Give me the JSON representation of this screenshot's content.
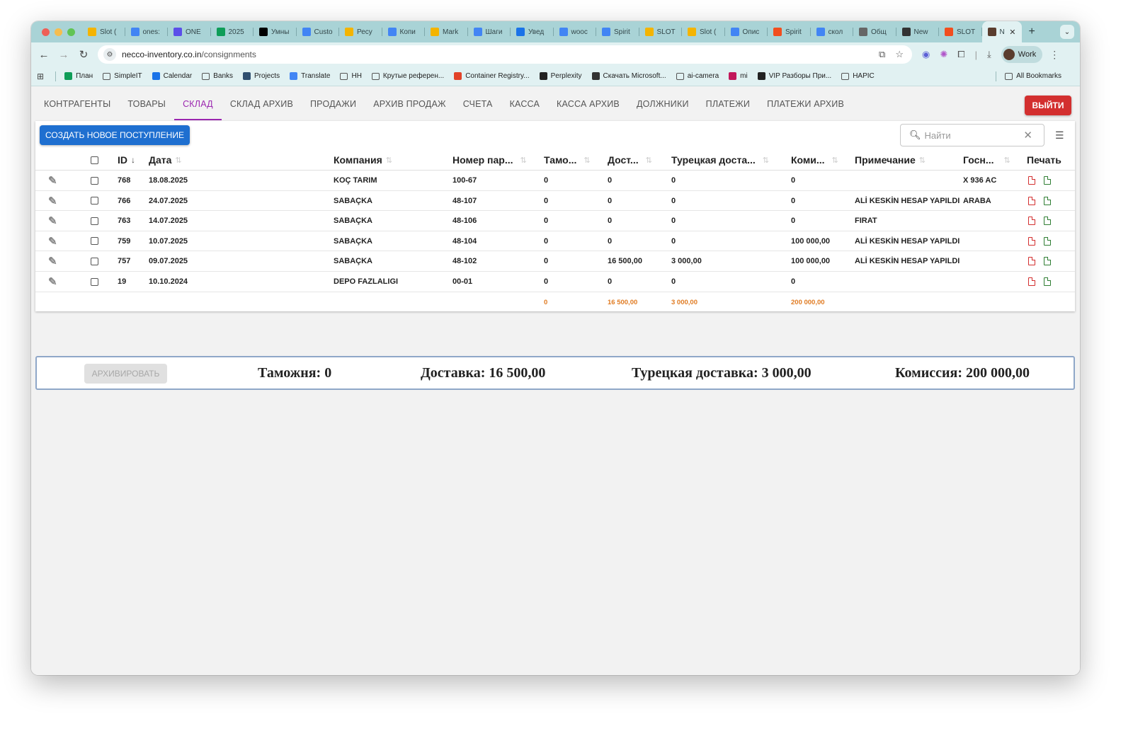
{
  "browser": {
    "tabs": [
      {
        "title": "Slot (",
        "icon": "google-drive-icon",
        "color": "#f4b400"
      },
      {
        "title": "ones:",
        "icon": "google-icon",
        "color": "#4285f4"
      },
      {
        "title": "ONE",
        "icon": "one-icon",
        "color": "#5b4fe9"
      },
      {
        "title": "2025",
        "icon": "sheets-icon",
        "color": "#0f9d58"
      },
      {
        "title": "Умны",
        "icon": "openai-icon",
        "color": "#000000"
      },
      {
        "title": "Custo",
        "icon": "google-icon",
        "color": "#4285f4"
      },
      {
        "title": "Ресу",
        "icon": "google-drive-icon",
        "color": "#f4b400"
      },
      {
        "title": "Копи",
        "icon": "docs-icon",
        "color": "#4285f4"
      },
      {
        "title": "Mark",
        "icon": "google-drive-icon",
        "color": "#f4b400"
      },
      {
        "title": "Шаги",
        "icon": "docs-icon",
        "color": "#4285f4"
      },
      {
        "title": "Увед",
        "icon": "blue-circle-icon",
        "color": "#1a73e8"
      },
      {
        "title": "wooc",
        "icon": "google-icon",
        "color": "#4285f4"
      },
      {
        "title": "Spirit",
        "icon": "docs-icon",
        "color": "#4285f4"
      },
      {
        "title": "SLOT",
        "icon": "google-drive-icon",
        "color": "#f4b400"
      },
      {
        "title": "Slot (",
        "icon": "google-drive-icon",
        "color": "#f4b400"
      },
      {
        "title": "Опис",
        "icon": "docs-icon",
        "color": "#4285f4"
      },
      {
        "title": "Spirit",
        "icon": "figma-icon",
        "color": "#f24e1e"
      },
      {
        "title": "скол",
        "icon": "google-icon",
        "color": "#4285f4"
      },
      {
        "title": "Общ",
        "icon": "chart-icon",
        "color": "#666666"
      },
      {
        "title": "New",
        "icon": "chatgpt-icon",
        "color": "#333333"
      },
      {
        "title": "SLOT",
        "icon": "figma-icon",
        "color": "#f24e1e"
      },
      {
        "title": "N",
        "icon": "app-icon",
        "color": "#5a3d2e",
        "active": true
      }
    ],
    "url_host": "necco-inventory.co.in",
    "url_path": "/consignments",
    "profile": "Work",
    "bookmarks": [
      {
        "label": "План",
        "icon": "sheets-icon"
      },
      {
        "label": "SimpleIT",
        "icon": "folder-icon"
      },
      {
        "label": "Calendar",
        "icon": "calendar-icon"
      },
      {
        "label": "Banks",
        "icon": "folder-icon"
      },
      {
        "label": "Projects",
        "icon": "projects-icon"
      },
      {
        "label": "Translate",
        "icon": "translate-icon"
      },
      {
        "label": "HH",
        "icon": "folder-icon"
      },
      {
        "label": "Крутые референ...",
        "icon": "folder-icon"
      },
      {
        "label": "Container Registry...",
        "icon": "gitlab-icon"
      },
      {
        "label": "Perplexity",
        "icon": "perplexity-icon"
      },
      {
        "label": "Скачать Microsoft...",
        "icon": "globe-icon"
      },
      {
        "label": "ai-camera",
        "icon": "folder-icon"
      },
      {
        "label": "mi",
        "icon": "mi-icon"
      },
      {
        "label": "VIP Разборы При...",
        "icon": "vip-icon"
      },
      {
        "label": "HAPIC",
        "icon": "folder-icon"
      }
    ],
    "all_bookmarks": "All Bookmarks"
  },
  "nav": {
    "items": [
      "КОНТРАГЕНТЫ",
      "ТОВАРЫ",
      "СКЛАД",
      "СКЛАД АРХИВ",
      "ПРОДАЖИ",
      "АРХИВ ПРОДАЖ",
      "СЧЕТА",
      "КАССА",
      "КАССА АРХИВ",
      "ДОЛЖНИКИ",
      "ПЛАТЕЖИ",
      "ПЛАТЕЖИ АРХИВ"
    ],
    "active": "СКЛАД",
    "logout": "ВЫЙТИ"
  },
  "toolbar": {
    "create": "СОЗДАТЬ НОВОЕ ПОСТУПЛЕНИЕ",
    "search_placeholder": "Найти"
  },
  "table": {
    "headers": {
      "id": "ID",
      "date": "Дата",
      "company": "Компания",
      "part": "Номер пар...",
      "customs": "Тамо...",
      "delivery": "Дост...",
      "turkish": "Турецкая доста...",
      "commission": "Коми...",
      "note": "Примечание",
      "plate": "Госн...",
      "print": "Печать"
    },
    "rows": [
      {
        "id": "768",
        "date": "18.08.2025",
        "company": "KOÇ TARIM",
        "part": "100-67",
        "customs": "0",
        "delivery": "0",
        "turkish": "0",
        "commission": "0",
        "note": "",
        "plate": "X 936 AC"
      },
      {
        "id": "766",
        "date": "24.07.2025",
        "company": "SABAÇKA",
        "part": "48-107",
        "customs": "0",
        "delivery": "0",
        "turkish": "0",
        "commission": "0",
        "note": "ALİ KESKİN HESAP YAPILDI",
        "plate": "ARABA"
      },
      {
        "id": "763",
        "date": "14.07.2025",
        "company": "SABAÇKA",
        "part": "48-106",
        "customs": "0",
        "delivery": "0",
        "turkish": "0",
        "commission": "0",
        "note": "FIRAT",
        "plate": ""
      },
      {
        "id": "759",
        "date": "10.07.2025",
        "company": "SABAÇKA",
        "part": "48-104",
        "customs": "0",
        "delivery": "0",
        "turkish": "0",
        "commission": "100 000,00",
        "note": "ALİ KESKİN HESAP YAPILDI",
        "plate": ""
      },
      {
        "id": "757",
        "date": "09.07.2025",
        "company": "SABAÇKA",
        "part": "48-102",
        "customs": "0",
        "delivery": "16 500,00",
        "turkish": "3 000,00",
        "commission": "100 000,00",
        "note": "ALİ KESKİN HESAP YAPILDI",
        "plate": ""
      },
      {
        "id": "19",
        "date": "10.10.2024",
        "company": "DEPO FAZLALIGI",
        "part": "00-01",
        "customs": "0",
        "delivery": "0",
        "turkish": "0",
        "commission": "0",
        "note": "",
        "plate": ""
      }
    ],
    "totals": {
      "customs": "0",
      "delivery": "16 500,00",
      "turkish": "3 000,00",
      "commission": "200 000,00"
    }
  },
  "summary": {
    "archive": "АРХИВИРОВАТЬ",
    "customs": "Таможня: 0",
    "delivery": "Доставка: 16 500,00",
    "turkish": "Турецкая доставка: 3 000,00",
    "commission": "Комиссия: 200 000,00"
  }
}
